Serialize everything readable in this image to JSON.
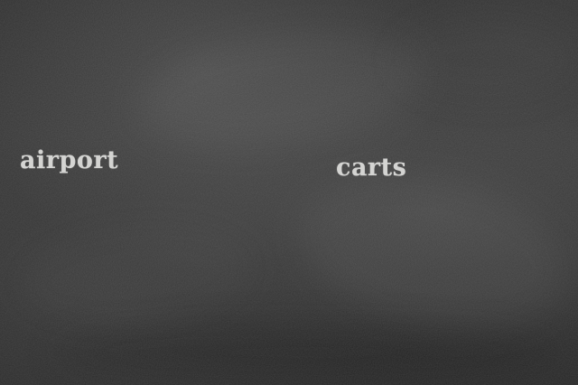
{
  "board": {
    "words": [
      "airport",
      "carts"
    ],
    "chalk_color": "#d4d4d2",
    "board_color": "#2e2e2e"
  }
}
